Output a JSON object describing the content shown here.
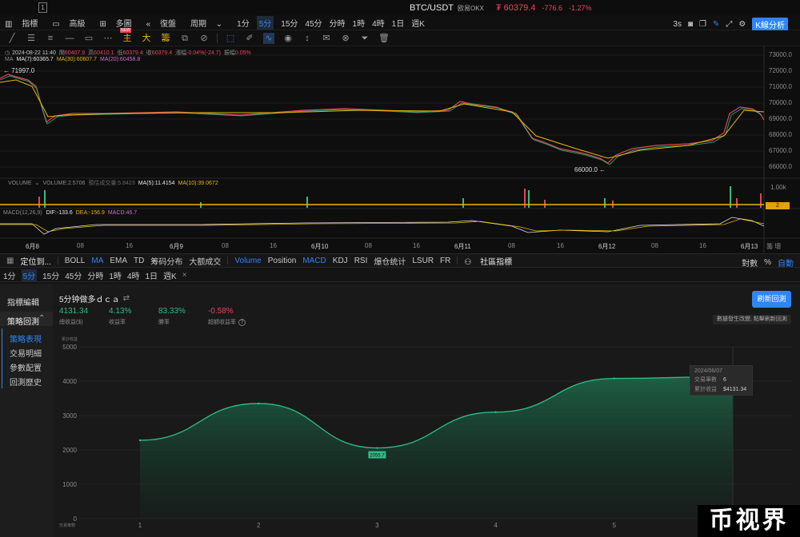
{
  "top": {
    "pair": "BTC/USDT",
    "exchange": "欧易OKX",
    "price": "₮ 60379.4",
    "change": "-776.6",
    "change_pct": "-1.27%",
    "menu_icon": "1"
  },
  "toolbar1": {
    "items": [
      "指標",
      "高級",
      "多圖",
      "復盤",
      "周期",
      "1分",
      "5分",
      "15分",
      "45分",
      "分時",
      "1時",
      "4時",
      "1日",
      "週K"
    ],
    "active_index": 6,
    "right": {
      "seconds": "3s",
      "kline_btn": "K線分析"
    }
  },
  "toolbar2": {
    "labels": {
      "main": "主",
      "big": "大",
      "chip": "籌"
    },
    "new_badge": "NEW"
  },
  "ohlc": {
    "date": "2024-08-22 11:40",
    "open_l": "開",
    "open": "60407.9",
    "high_l": "高",
    "high": "60410.1",
    "low_l": "低",
    "low": "60379.4",
    "close_l": "收",
    "close": "60379.4",
    "chg_l": "漲幅",
    "chg": "-0.04%(-24.7)",
    "amp_l": "振幅",
    "amp": "0.05%"
  },
  "ma": {
    "label": "MA",
    "ma7": "MA(7):60365.7",
    "ma30": "MA(30):60607.7",
    "ma20": "MA(20):60458.8"
  },
  "price_axis": [
    "73000.0",
    "72000.0",
    "71000.0",
    "70000.0",
    "69000.0",
    "68000.0",
    "67000.0",
    "66000.0"
  ],
  "annotations": {
    "high": "← 71997.0",
    "low": "66000.0 ←"
  },
  "volume": {
    "label": "VOLUME",
    "v": "VOLUME:2.5706",
    "est": "預估成交量:5.8423",
    "ma5": "MA(5):11.4154",
    "ma10": "MA(10):39.0672",
    "axis": "1.00k",
    "badge": "2"
  },
  "macd": {
    "label": "MACD(12,26,9)",
    "dif": "DIF:-133.6",
    "dea": "DEA:-156.9",
    "macd": "MACD:46.7"
  },
  "date_axis": [
    "6月8",
    "08",
    "16",
    "6月9",
    "08",
    "16",
    "6月10",
    "08",
    "16",
    "6月11",
    "08",
    "16",
    "6月12",
    "08",
    "16",
    "6月13"
  ],
  "corner": "籌 壞",
  "indicators": {
    "pin": "定位到...",
    "items": [
      "BOLL",
      "MA",
      "EMA",
      "TD",
      "筹码分布",
      "大额成交"
    ],
    "sub": [
      "Volume",
      "Position",
      "MACD",
      "KDJ",
      "RSI",
      "爆仓统计",
      "LSUR",
      "FR"
    ],
    "community": "社區指標",
    "right": [
      "對數",
      "%",
      "自動"
    ]
  },
  "timeframes": {
    "items": [
      "1分",
      "5分",
      "15分",
      "45分",
      "分時",
      "1時",
      "4時",
      "1日",
      "週K"
    ],
    "active_index": 1,
    "close": "×"
  },
  "sidebar": {
    "title": "指標編輯",
    "section": "策略回測",
    "items": [
      "策略表現",
      "交易明細",
      "參數配置",
      "回測歷史"
    ],
    "active_index": 0
  },
  "strategy": {
    "name": "5分钟做多ｄｃａ",
    "swap": "⇄",
    "refresh": "刷新回測",
    "note": "數據發生改變, 點擊刷新回測",
    "stats": [
      {
        "value": "4131.34",
        "label": "總收益($)",
        "color": "green"
      },
      {
        "value": "4.13%",
        "label": "收益率",
        "color": "green"
      },
      {
        "value": "83.33%",
        "label": "勝率",
        "color": "green"
      },
      {
        "value": "-0.58%",
        "label": "超額收益率",
        "color": "red"
      }
    ]
  },
  "tooltip": {
    "date": "2024/06/07",
    "count_l": "交易筆數",
    "count": "6",
    "profit_l": "累計收益",
    "profit": "$4131.34"
  },
  "chart_data": {
    "type": "area",
    "title": "",
    "ylabel": "累計收益",
    "xlabel": "交易筆數",
    "ylim": [
      0,
      5000
    ],
    "yticks": [
      "5000",
      "4000",
      "3000",
      "2000",
      "1000",
      "0"
    ],
    "x": [
      1,
      2,
      3,
      4,
      5,
      6
    ],
    "values": [
      2280,
      3350,
      2056,
      3100,
      4080,
      4131.34
    ],
    "point_label": "2055.7",
    "xticks": [
      "1",
      "2",
      "3",
      "4",
      "5"
    ]
  },
  "watermark": "币视界"
}
